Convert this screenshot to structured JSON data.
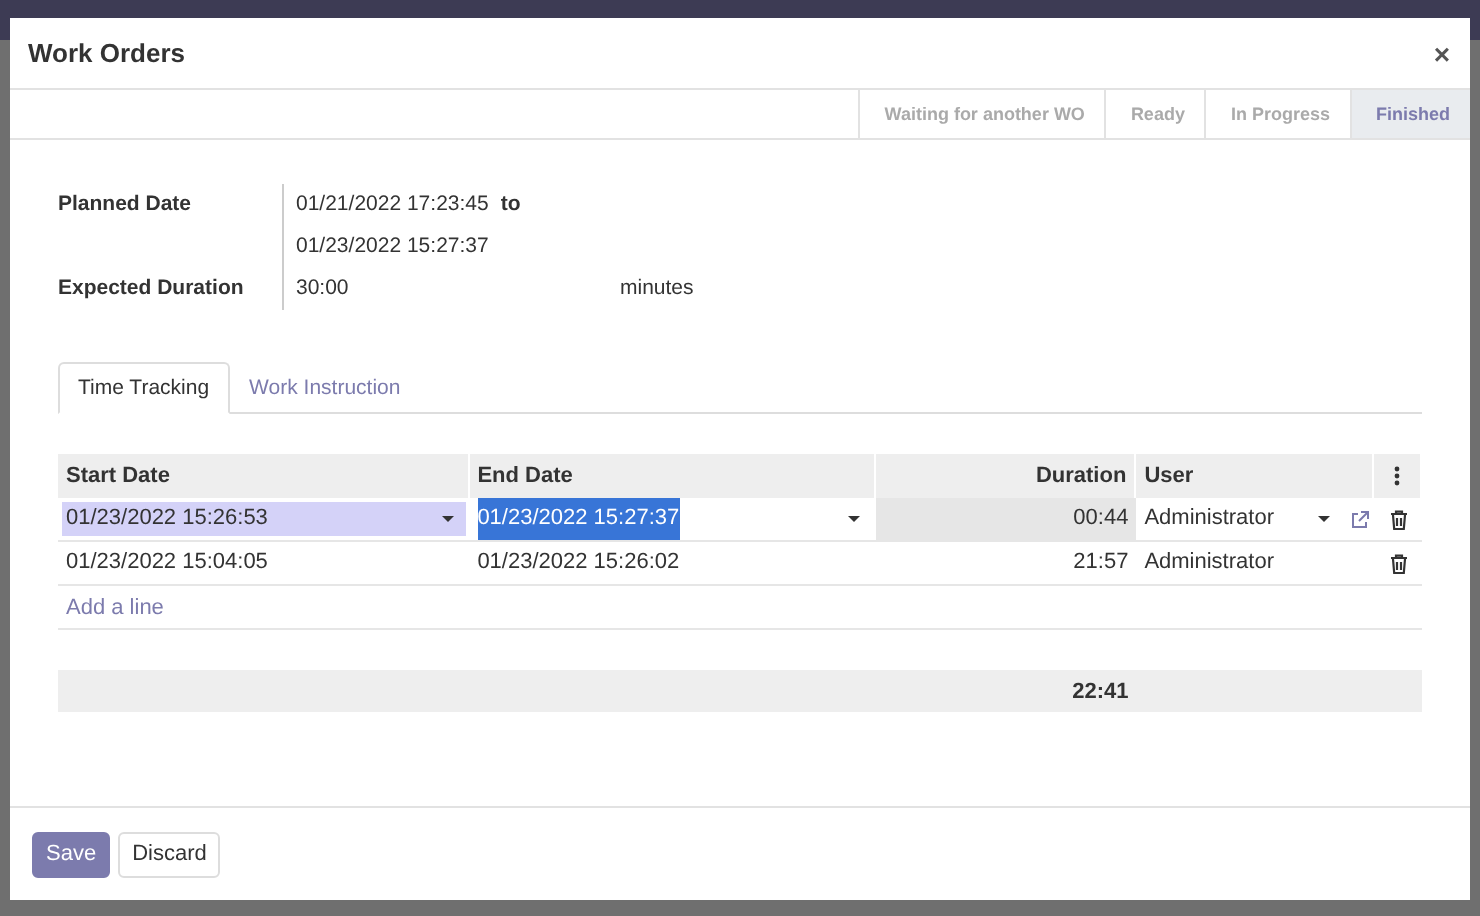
{
  "dialog": {
    "title": "Work Orders",
    "close": "×"
  },
  "status_bar": [
    {
      "label": "Waiting for another WO",
      "selected": false
    },
    {
      "label": "Ready",
      "selected": false
    },
    {
      "label": "In Progress",
      "selected": false
    },
    {
      "label": "Finished",
      "selected": true
    }
  ],
  "form": {
    "planned_date_label": "Planned Date",
    "planned_start": "01/21/2022 17:23:45",
    "to": "to",
    "planned_end": "01/23/2022 15:27:37",
    "expected_duration_label": "Expected Duration",
    "expected_duration": "30:00",
    "unit": "minutes"
  },
  "tabs": [
    {
      "label": "Time Tracking",
      "selected": true
    },
    {
      "label": "Work Instruction",
      "selected": false
    }
  ],
  "table": {
    "columns": [
      "Start Date",
      "End Date",
      "Duration",
      "User"
    ],
    "rows": [
      {
        "start": "01/23/2022 15:26:53",
        "end": "01/23/2022 15:27:37",
        "duration": "00:44",
        "user": "Administrator",
        "editing": true
      },
      {
        "start": "01/23/2022 15:04:05",
        "end": "01/23/2022 15:26:02",
        "duration": "21:57",
        "user": "Administrator",
        "editing": false
      }
    ],
    "add_line": "Add a line",
    "total": "22:41"
  },
  "buttons": [
    {
      "label": "Save",
      "kind": "primary"
    },
    {
      "label": "Discard",
      "kind": "secondary"
    }
  ]
}
